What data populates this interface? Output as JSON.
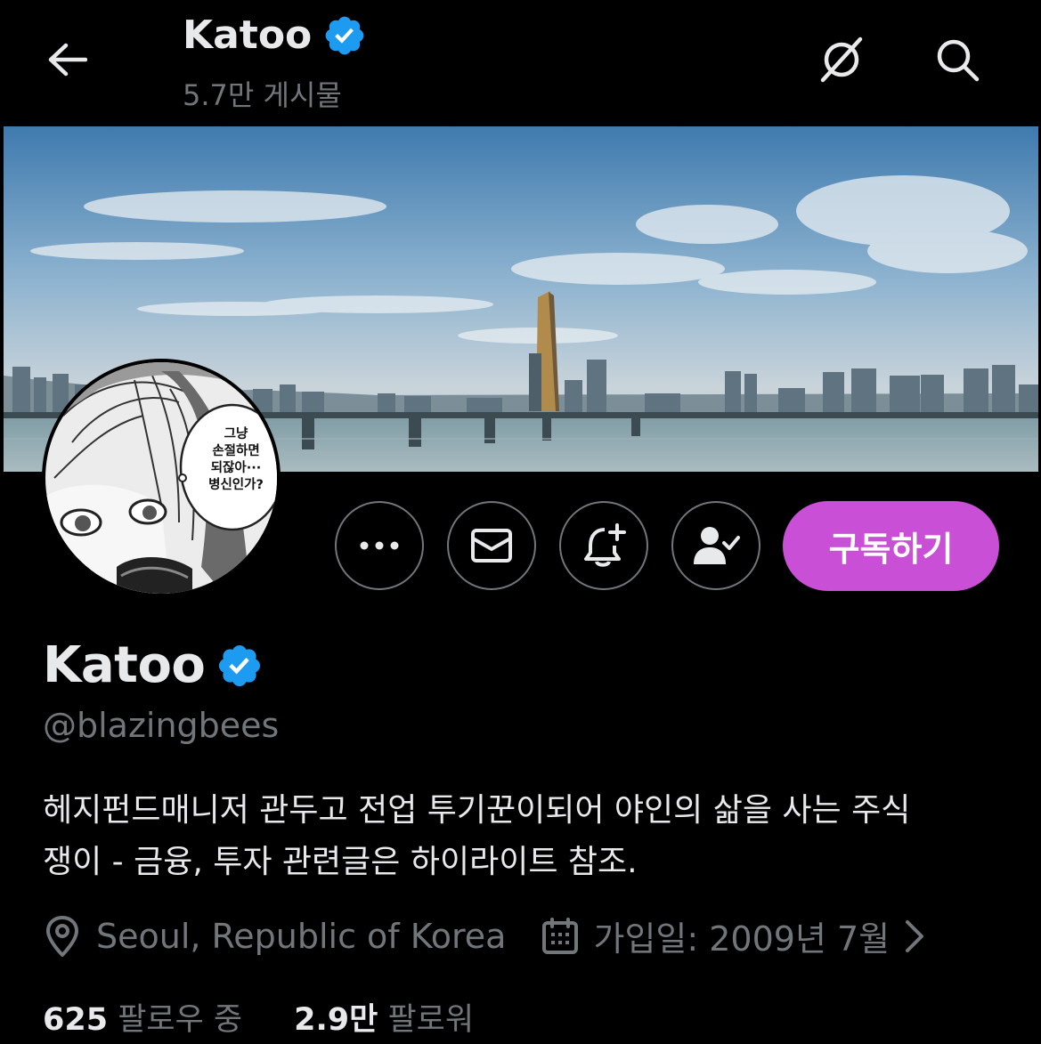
{
  "topbar": {
    "back_icon": "arrow-left-icon",
    "name": "Katoo",
    "verified_icon": "verified-badge-icon",
    "posts": "5.7만 게시물",
    "grok_icon": "slashed-circle-icon",
    "search_icon": "search-icon"
  },
  "actions": {
    "more_icon": "more-horizontal-icon",
    "message_icon": "envelope-icon",
    "notify_icon": "bell-plus-icon",
    "following_icon": "person-check-icon",
    "subscribe_label": "구독하기"
  },
  "avatar_bubble": {
    "lines": [
      "그냥",
      "손절하면",
      "되잖아···",
      "병신인가?"
    ]
  },
  "profile": {
    "name": "Katoo",
    "handle": "@blazingbees",
    "bio_line1": "헤지펀드매니저 관두고 전업 투기꾼이되어 야인의 삶을 사는 주식",
    "bio_line2": "쟁이 - 금융, 투자 관련글은 하이라이트 참조.",
    "location": "Seoul, Republic of Korea",
    "joined": "가입일: 2009년 7월",
    "following_count": "625",
    "following_label": "팔로우 중",
    "followers_count": "2.9만",
    "followers_label": "팔로워"
  },
  "colors": {
    "background": "#000000",
    "text": "#e7e9ea",
    "muted": "#71767b",
    "verified": "#1d9bf0",
    "subscribe": "#c94fd6"
  }
}
